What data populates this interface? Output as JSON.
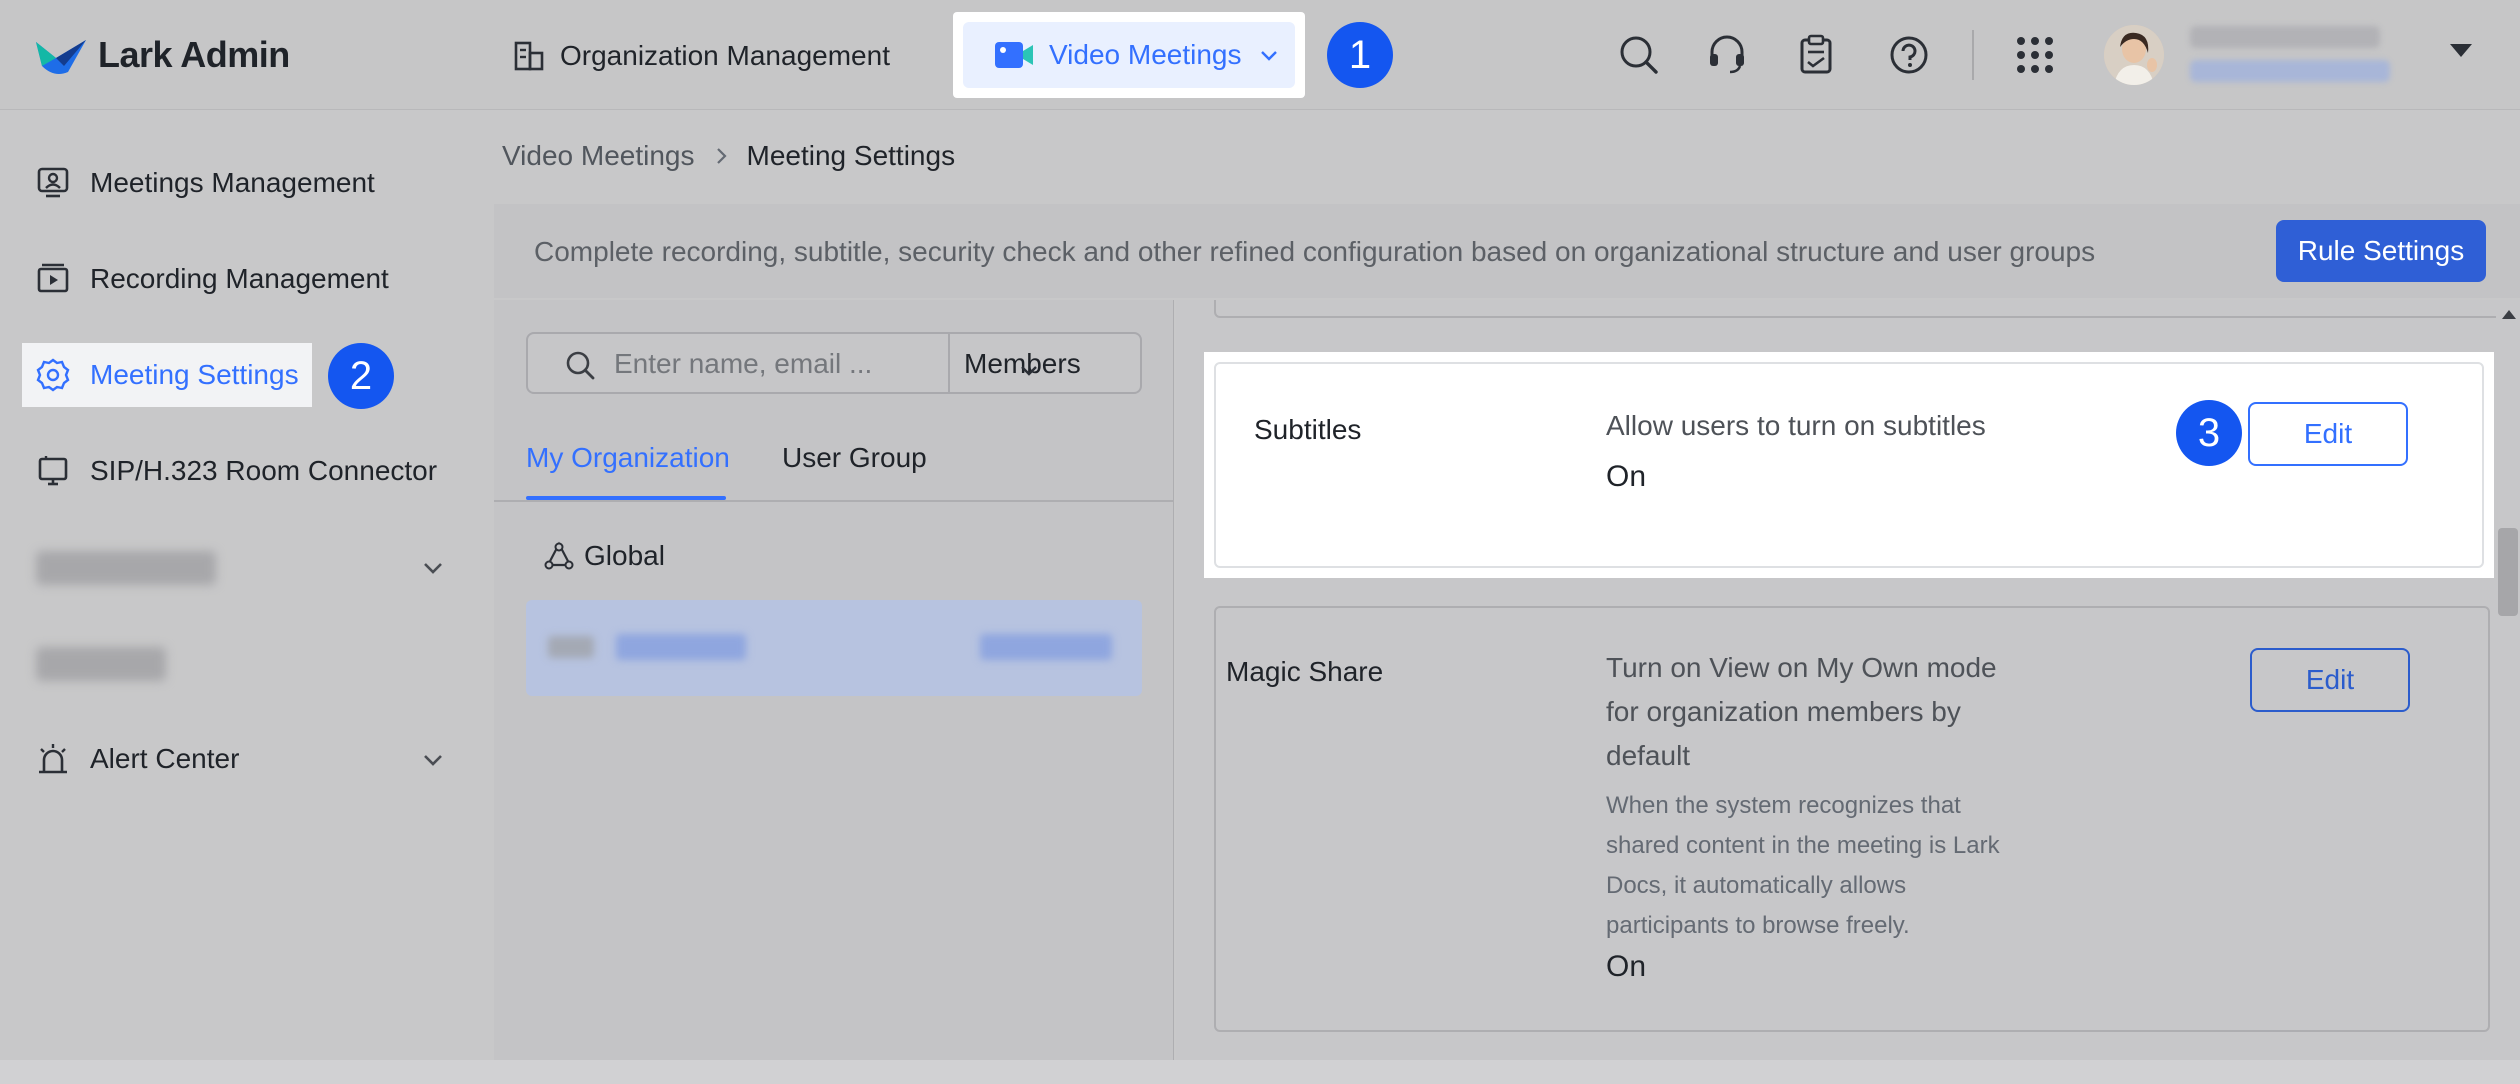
{
  "app": {
    "name": "Lark Admin"
  },
  "top_nav": {
    "org_label": "Organization Management",
    "video_label": "Video Meetings"
  },
  "badges": [
    "1",
    "2",
    "3"
  ],
  "sidebar": {
    "items": [
      {
        "label": "Meetings Management"
      },
      {
        "label": "Recording Management"
      },
      {
        "label": "Meeting Settings"
      },
      {
        "label": "SIP/H.323 Room Connector"
      },
      {
        "label": "Alert Center"
      }
    ]
  },
  "breadcrumb": {
    "parent": "Video Meetings",
    "current": "Meeting Settings"
  },
  "banner": {
    "text": "Complete recording, subtitle, security check and other refined configuration based on organizational structure and user groups",
    "rule_button": "Rule Settings"
  },
  "left_panel": {
    "search_placeholder": "Enter name, email ...",
    "filter_label": "Members",
    "tabs": [
      "My Organization",
      "User Group"
    ],
    "tree_root": "Global"
  },
  "settings": [
    {
      "title": "Subtitles",
      "description": "Allow users to turn on subtitles",
      "value": "On",
      "edit_label": "Edit"
    },
    {
      "title": "Magic Share",
      "description": "Turn on View on My Own mode for organization members by default",
      "note": "When the system recognizes that shared content in the meeting is Lark Docs, it automatically allows participants to browse freely.",
      "value": "On",
      "edit_label": "Edit"
    }
  ],
  "colors": {
    "accent": "#3370ff",
    "badge": "#1456f0",
    "rule_button": "#2f5fd6"
  }
}
